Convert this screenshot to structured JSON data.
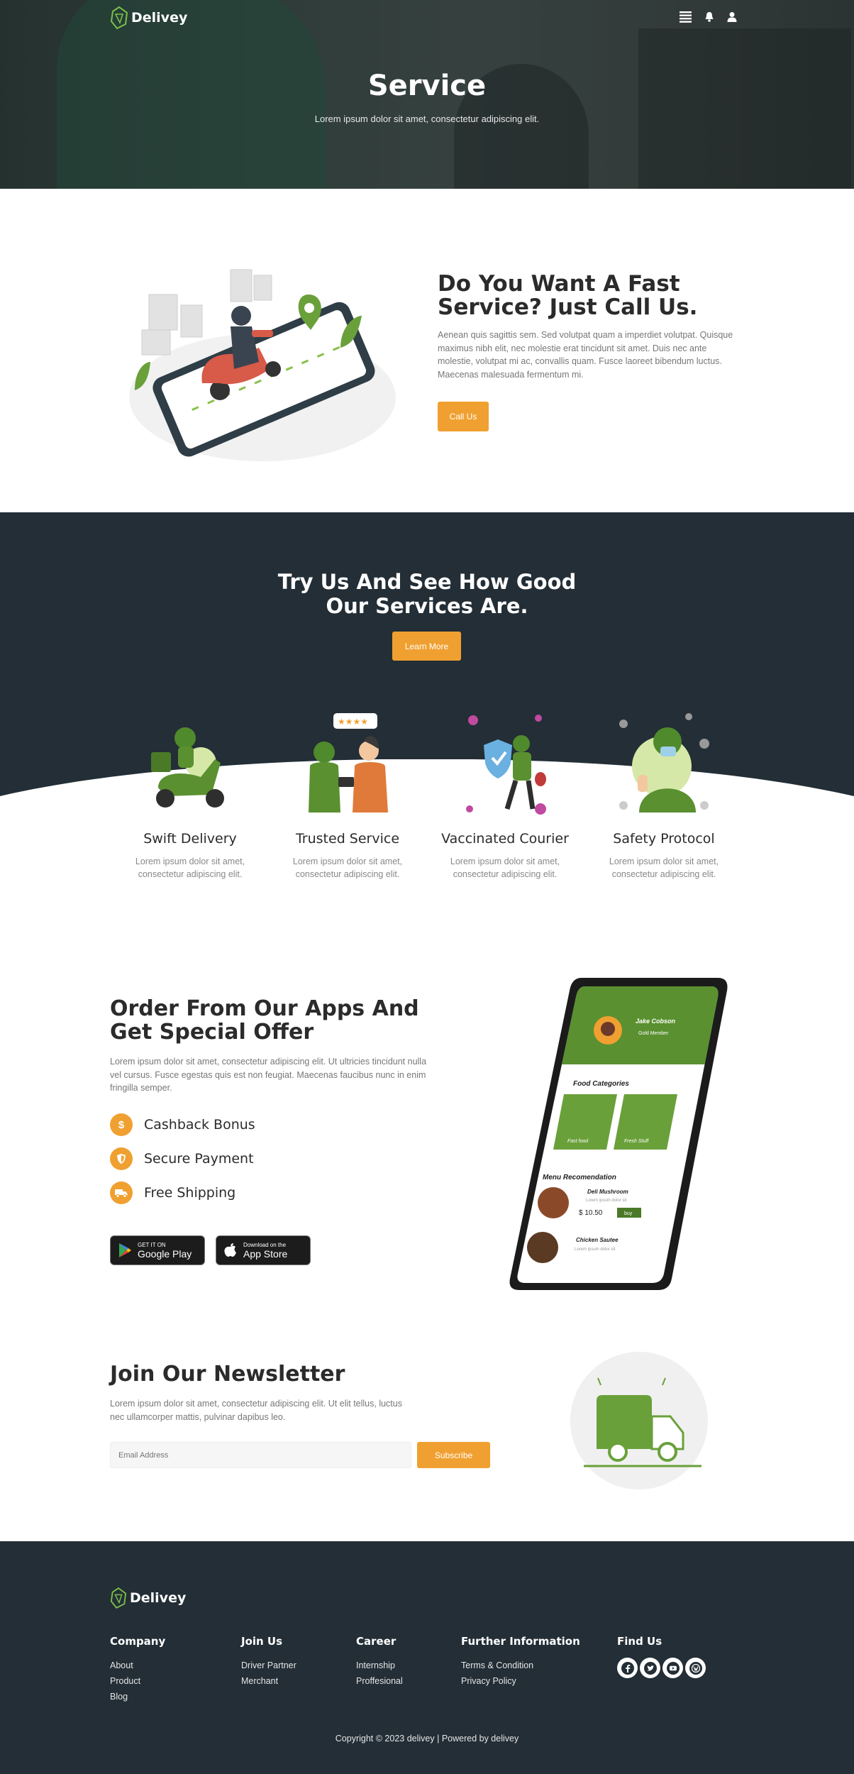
{
  "brand": {
    "name": "Delivey",
    "accent": "#f0a030",
    "green": "#6aa03a",
    "dark": "#232e36"
  },
  "nav": {
    "icons": [
      "menu-list-icon",
      "bell-icon",
      "user-icon"
    ]
  },
  "hero": {
    "title": "Service",
    "subtitle": "Lorem ipsum dolor sit amet, consectetur adipiscing elit."
  },
  "call_section": {
    "title": "Do You Want A Fast Service? Just Call Us.",
    "text": "Aenean quis sagittis sem. Sed volutpat quam a imperdiet volutpat. Quisque maximus nibh elit, nec molestie erat tincidunt sit amet. Duis nec ante molestie, volutpat mi ac, convallis quam. Fusce laoreet bibendum luctus. Maecenas malesuada fermentum mi.",
    "button": "Call Us"
  },
  "try_section": {
    "title": "Try Us And See How Good Our Services Are.",
    "button": "Learn More",
    "features": [
      {
        "title": "Swift Delivery",
        "text": "Lorem ipsum dolor sit amet, consectetur adipiscing elit."
      },
      {
        "title": "Trusted Service",
        "text": "Lorem ipsum dolor sit amet, consectetur adipiscing elit."
      },
      {
        "title": "Vaccinated Courier",
        "text": "Lorem ipsum dolor sit amet, consectetur adipiscing elit."
      },
      {
        "title": "Safety Protocol",
        "text": "Lorem ipsum dolor sit amet, consectetur adipiscing elit."
      }
    ]
  },
  "app_section": {
    "title": "Order From Our Apps And Get Special Offer",
    "text": "Lorem ipsum dolor sit amet, consectetur adipiscing elit. Ut ultricies tincidunt nulla vel cursus. Fusce egestas quis est non feugiat. Maecenas faucibus nunc in enim fringilla semper.",
    "perks": [
      {
        "icon": "dollar-icon",
        "label": "Cashback Bonus"
      },
      {
        "icon": "shield-icon",
        "label": "Secure Payment"
      },
      {
        "icon": "truck-icon",
        "label": "Free Shipping"
      }
    ],
    "stores": [
      {
        "small": "GET IT ON",
        "big": "Google Play"
      },
      {
        "small": "Download on the",
        "big": "App Store"
      }
    ],
    "phone": {
      "user": "Jake Cobson",
      "member": "Gold Member",
      "categories_title": "Food Categories",
      "categories": [
        "Fast food",
        "Fresh Stuff"
      ],
      "menu_title": "Menu Recomendation",
      "items": [
        {
          "name": "Deli Mushroom",
          "desc": "Lorem ipsum dolor sit",
          "price": "$ 10.50",
          "action": "buy"
        },
        {
          "name": "Chicken Sautee",
          "desc": "Lorem ipsum dolor sit"
        }
      ]
    }
  },
  "newsletter": {
    "title": "Join Our Newsletter",
    "text": "Lorem ipsum dolor sit amet, consectetur adipiscing elit. Ut elit tellus, luctus nec ullamcorper mattis, pulvinar dapibus leo.",
    "placeholder": "Email Address",
    "button": "Subscribe"
  },
  "footer": {
    "columns": [
      {
        "title": "Company",
        "links": [
          "About",
          "Product",
          "Blog"
        ]
      },
      {
        "title": "Join Us",
        "links": [
          "Driver Partner",
          "Merchant"
        ]
      },
      {
        "title": "Career",
        "links": [
          "Internship",
          "Proffesional"
        ]
      },
      {
        "title": "Further Information",
        "links": [
          "Terms & Condition",
          "Privacy Policy"
        ]
      }
    ],
    "find_us": {
      "title": "Find Us",
      "icons": [
        "facebook-icon",
        "twitter-icon",
        "youtube-icon",
        "wordpress-icon"
      ]
    },
    "copyright": "Copyright © 2023 delivey | Powered by delivey"
  }
}
